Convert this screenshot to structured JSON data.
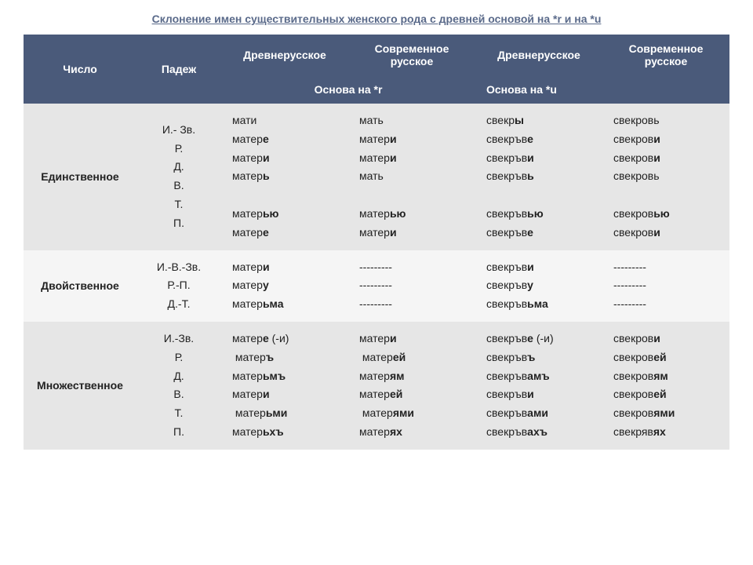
{
  "title": "Склонение имен существительных женского рода с древней основой на *r и на *u",
  "header": {
    "col_number": "Число",
    "col_case": "Падеж",
    "col_oldru_r": "Древнерусское",
    "col_modru_r": "Современное русское",
    "col_oldru_u": "Древнерусское",
    "col_modru_u": "Современное русское",
    "sub_r": "Основа на *r",
    "sub_u": "Основа на *u"
  },
  "rows": [
    {
      "label": "Единственное",
      "cases": "И.- Зв.\nР.\nД.\nВ.\nТ.\nП.",
      "c2": "мати\nматер<b>е</b>\nматер<b>и</b>\nматер<b>ь</b>\n&nbsp;\nматер<b>ью</b>\nматер<b>е</b>",
      "c3": "мать\nматер<b>и</b>\nматер<b>и</b>\nмать\n&nbsp;\nматер<b>ью</b>\nматер<b>и</b>",
      "c4": "свекр<b>ы</b>\nсвекръв<b>е</b>\nсвекръв<b>и</b>\nсвекръв<b>ь</b>\n&nbsp;\nсвекръв<b>ью</b>\nсвекръв<b>е</b>",
      "c5": "свекровь\nсвекров<b>и</b>\nсвекров<b>и</b>\nсвекровь\n&nbsp;\nсвекров<b>ью</b>\nсвекров<b>и</b>"
    },
    {
      "label": "Двойственное",
      "cases": "И.-В.-Зв.\nР.-П.\nД.-Т.",
      "c2": "матер<b>и</b>\nматер<b>у</b>\nматер<b>ьма</b>",
      "c3": "---------\n---------\n---------",
      "c4": "свекръв<b>и</b>\nсвекръв<b>у</b>\nсвекръв<b>ьма</b>",
      "c5": "---------\n---------\n---------"
    },
    {
      "label": "Множественное",
      "cases": "И.-Зв.\nР.\nД.\nВ.\nТ.\nП.",
      "c2": "матер<b>е</b> (-и)\n&nbsp;матер<b>ъ</b>\nматер<b>ьмъ</b>\nматер<b>и</b>\n&nbsp;матер<b>ьми</b>\nматер<b>ьхъ</b>",
      "c3": "матер<b>и</b>\n&nbsp;матер<b>ей</b>\nматер<b>ям</b>\nматер<b>ей</b>\n&nbsp;матер<b>ями</b>\nматер<b>ях</b>",
      "c4": "свекръв<b>е</b> (-и)\nсвекръв<b>ъ</b>\nсвекръв<b>амъ</b>\nсвекръв<b>и</b>\nсвекръв<b>ами</b>\nсвекръв<b>ахъ</b>",
      "c5": "свекров<b>и</b>\nсвекров<b>ей</b>\nсвекров<b>ям</b>\nсвекров<b>ей</b>\nсвекров<b>ями</b>\nсвекряв<b>ях</b>"
    }
  ]
}
